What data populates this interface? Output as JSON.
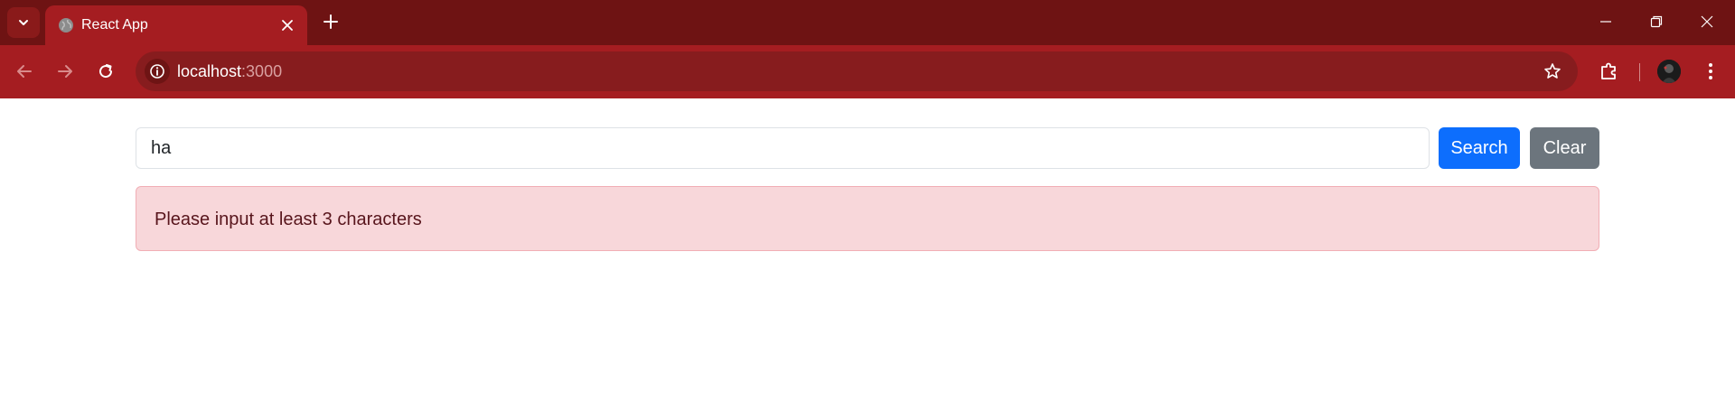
{
  "browser": {
    "tab": {
      "title": "React App"
    },
    "address_bar": {
      "host": "localhost",
      "port": ":3000"
    },
    "icons": {
      "tab_search": "chevron-down-icon",
      "favicon": "globe-icon",
      "tab_close": "close-icon",
      "new_tab": "plus-icon",
      "minimize": "minimize-icon",
      "restore": "restore-icon",
      "close_window": "close-icon",
      "back": "back-arrow-icon",
      "forward": "forward-arrow-icon",
      "reload": "reload-icon",
      "site_info": "info-icon",
      "bookmark": "star-icon",
      "extensions": "puzzle-icon",
      "profile": "avatar",
      "menu": "kebab-menu-icon"
    },
    "colors": {
      "tabstrip": "#6e1313",
      "toolbar": "#a51d21",
      "omnibox": "#871c1e"
    }
  },
  "page": {
    "search": {
      "value": "ha",
      "placeholder": ""
    },
    "buttons": {
      "search": "Search",
      "clear": "Clear"
    },
    "alert": {
      "message": "Please input at least 3 characters"
    },
    "colors": {
      "search_button": "#0d6efd",
      "clear_button": "#6c757d",
      "alert_background": "#f8d7da",
      "alert_text": "#58151c"
    }
  }
}
